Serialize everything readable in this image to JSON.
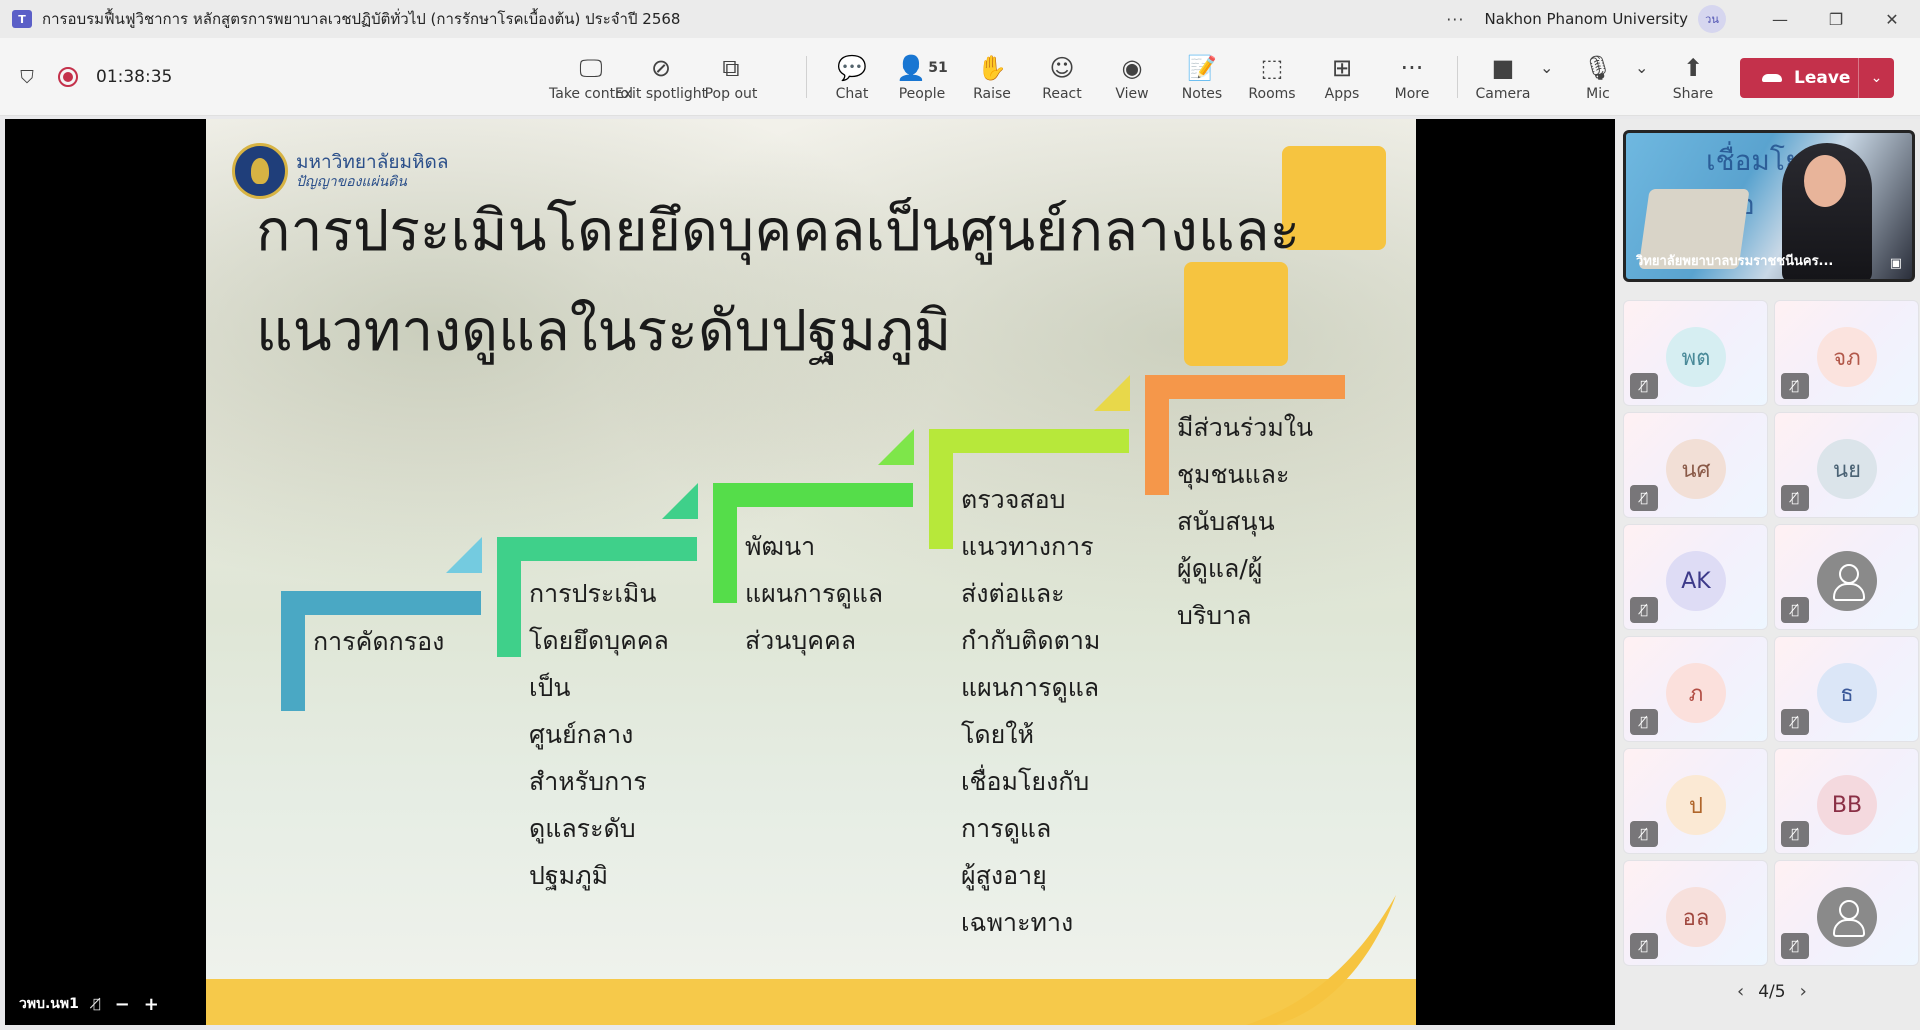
{
  "window": {
    "title": "การอบรมฟื้นฟูวิชาการ หลักสูตรการพยาบาลเวชปฏิบัติทั่วไป (การรักษาโรคเบื้องต้น) ประจำปี 2568",
    "more_dots": "···",
    "org_name": "Nakhon Phanom University",
    "org_avatar": "วน",
    "minimize": "—",
    "restore": "❐",
    "close": "✕"
  },
  "toolbar": {
    "timer": "01:38:35",
    "items": [
      {
        "label": "Take control",
        "icon": "take-control-icon",
        "glyph": "🖵"
      },
      {
        "label": "Exit spotlight",
        "icon": "exit-spotlight-icon",
        "glyph": "⊘"
      },
      {
        "label": "Pop out",
        "icon": "pop-out-icon",
        "glyph": "⧉"
      },
      {
        "label": "Chat",
        "icon": "chat-icon",
        "glyph": "💬"
      },
      {
        "label": "People",
        "icon": "people-icon",
        "glyph": "👤",
        "count": "51"
      },
      {
        "label": "Raise",
        "icon": "raise-hand-icon",
        "glyph": "✋"
      },
      {
        "label": "React",
        "icon": "react-icon",
        "glyph": "☺"
      },
      {
        "label": "View",
        "icon": "view-icon",
        "glyph": "◉"
      },
      {
        "label": "Notes",
        "icon": "notes-icon",
        "glyph": "📝"
      },
      {
        "label": "Rooms",
        "icon": "rooms-icon",
        "glyph": "⬚"
      },
      {
        "label": "Apps",
        "icon": "apps-icon",
        "glyph": "⊞"
      },
      {
        "label": "More",
        "icon": "more-icon",
        "glyph": "···"
      },
      {
        "label": "Camera",
        "icon": "camera-icon",
        "glyph": "■"
      },
      {
        "label": "Mic",
        "icon": "mic-icon",
        "glyph": "🎙"
      },
      {
        "label": "Share",
        "icon": "share-icon",
        "glyph": "⬆"
      }
    ],
    "leave_label": "Leave",
    "colors": {
      "leave": "#c4314b"
    }
  },
  "slide": {
    "university_name": "มหาวิทยาลัยมหิดล",
    "university_motto": "ปัญญาของแผ่นดิน",
    "title": "การประเมินโดยยึดบุคคลเป็นศูนย์กลางและแนวทางดูแลในระดับปฐมภูมิ",
    "title_line1": "การประเมินโดยยึดบุคคลเป็นศูนย์กลางและ",
    "title_line2": "แนวทางดูแลในระดับปฐมภูมิ",
    "steps": [
      {
        "color": "#4aa8c4",
        "text": "การคัดกรอง"
      },
      {
        "color": "#3fd08a",
        "text": "การประเมิน\nโดยยึดบุคคล\nเป็น\nศูนย์กลาง\nสำหรับการ\nดูแลระดับ\nปฐมภูมิ"
      },
      {
        "color": "#55dd4a",
        "text": "พัฒนา\nแผนการดูแล\nส่วนบุคคล"
      },
      {
        "color": "#b7e83a",
        "text": "ตรวจสอบ\nแนวทางการ\nส่งต่อและ\nกำกับติดตาม\nแผนการดูแล\nโดยให้\nเชื่อมโยงกับ\nการดูแล\nผู้สูงอายุ\nเฉพาะทาง"
      },
      {
        "color": "#f5974a",
        "text": "มีส่วนร่วมใน\nชุมชนและ\nสนับสนุน\nผู้ดูแล/ผู้\nบริบาล"
      }
    ],
    "accent_color": "#f6c440"
  },
  "presenter": {
    "name": "วพบ.นพ1"
  },
  "side_panel": {
    "spotlight": {
      "name": "วิทยาลัยพยาบาลบรมราชชนีนคร...",
      "background_text": "เชื่อมโย\nกรอ\nจัย"
    },
    "tiles": [
      {
        "initials": "พต",
        "bg": "#d6eef2",
        "fg": "#4a8a99"
      },
      {
        "initials": "จภ",
        "bg": "#fbe3de",
        "fg": "#b2584a"
      },
      {
        "initials": "นศ",
        "bg": "#f2dfd6",
        "fg": "#8a5a48"
      },
      {
        "initials": "นย",
        "bg": "#dbe4ea",
        "fg": "#4a6274"
      },
      {
        "initials": "AK",
        "bg": "#dedcf5",
        "fg": "#3d3a8a"
      },
      {
        "initials": "",
        "bg": "#8a8a8a",
        "fg": "#ffffff",
        "generic": true
      },
      {
        "initials": "ภ",
        "bg": "#fbe0dc",
        "fg": "#b24e45"
      },
      {
        "initials": "ธ",
        "bg": "#dbe6f7",
        "fg": "#3c5a9a"
      },
      {
        "initials": "ป",
        "bg": "#fbe9d4",
        "fg": "#b0662a"
      },
      {
        "initials": "BB",
        "bg": "#f4d9de",
        "fg": "#8a2f45"
      },
      {
        "initials": "อล",
        "bg": "#f7e0dc",
        "fg": "#a0473e"
      },
      {
        "initials": "",
        "bg": "#8a8a8a",
        "fg": "#ffffff",
        "generic": true
      }
    ],
    "page_indicator": "4/5"
  }
}
